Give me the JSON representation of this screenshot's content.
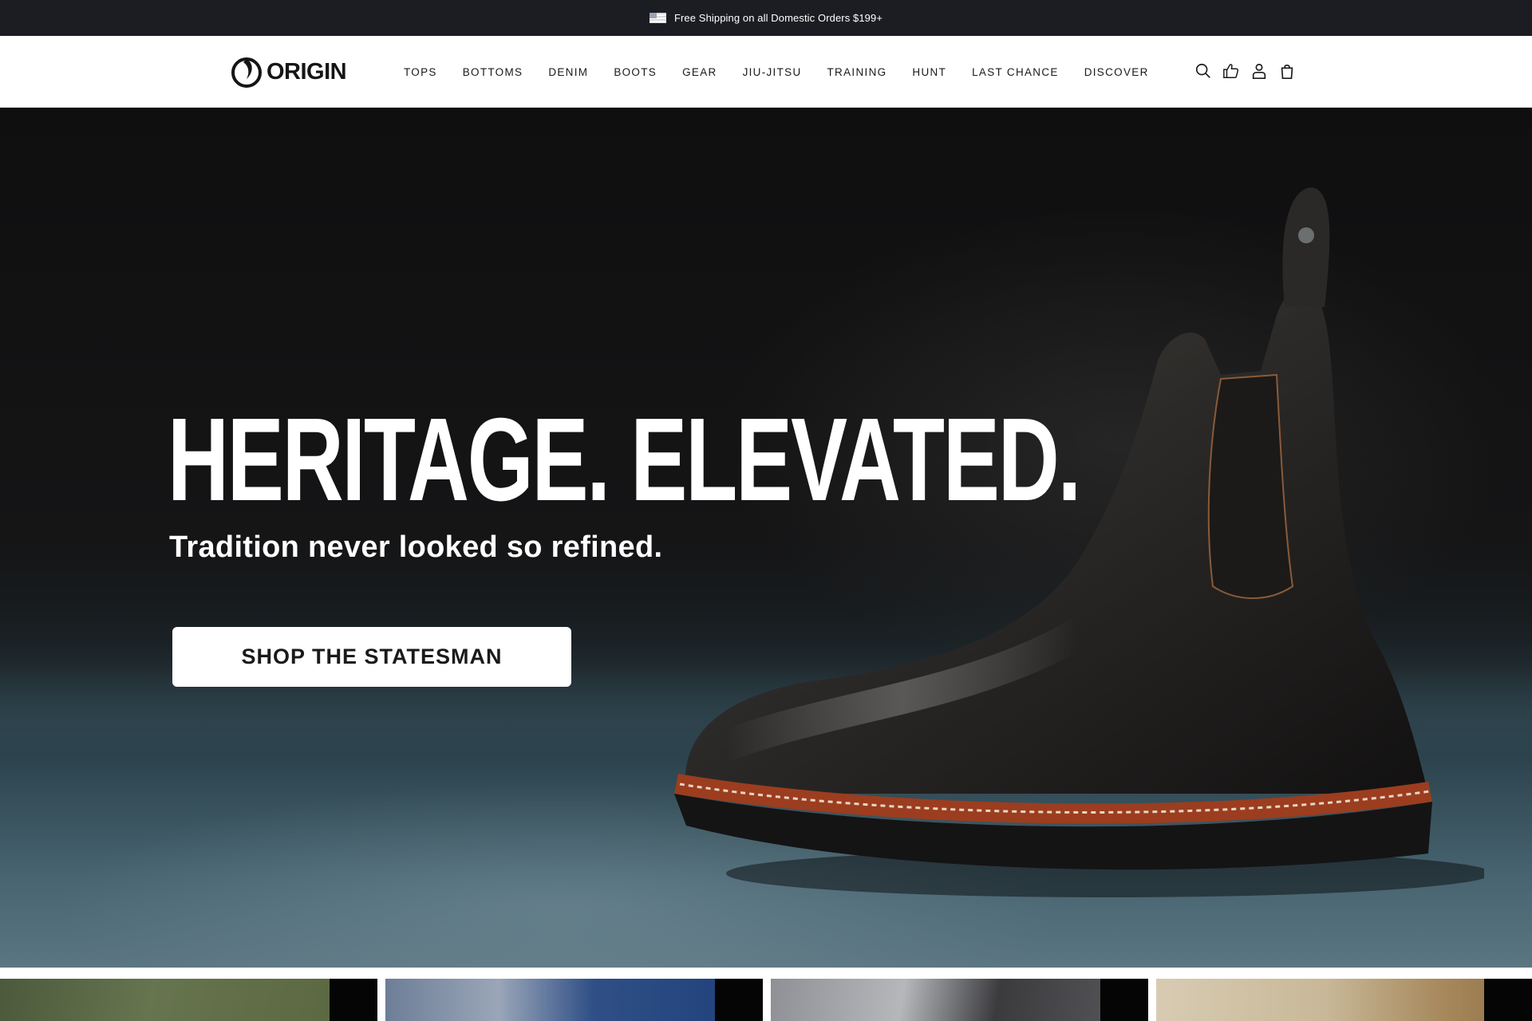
{
  "announcement": {
    "text": "Free Shipping on all Domestic Orders $199+",
    "flag_icon": "us-flag-icon"
  },
  "header": {
    "logo_text": "ORIGIN",
    "nav": [
      {
        "label": "TOPS"
      },
      {
        "label": "BOTTOMS"
      },
      {
        "label": "DENIM"
      },
      {
        "label": "BOOTS"
      },
      {
        "label": "GEAR"
      },
      {
        "label": "JIU-JITSU"
      },
      {
        "label": "TRAINING"
      },
      {
        "label": "HUNT"
      },
      {
        "label": "LAST CHANCE"
      },
      {
        "label": "DISCOVER"
      }
    ],
    "icons": [
      "search-icon",
      "thumbs-up-icon",
      "account-icon",
      "cart-icon"
    ]
  },
  "hero": {
    "title": "HERITAGE. ELEVATED.",
    "subtitle": "Tradition never looked so refined.",
    "cta_label": "SHOP THE STATESMAN"
  },
  "colors": {
    "announcement_bg": "#1b1d23",
    "header_bg": "#ffffff",
    "cta_bg": "#ffffff",
    "cta_text": "#1a1a1a"
  }
}
